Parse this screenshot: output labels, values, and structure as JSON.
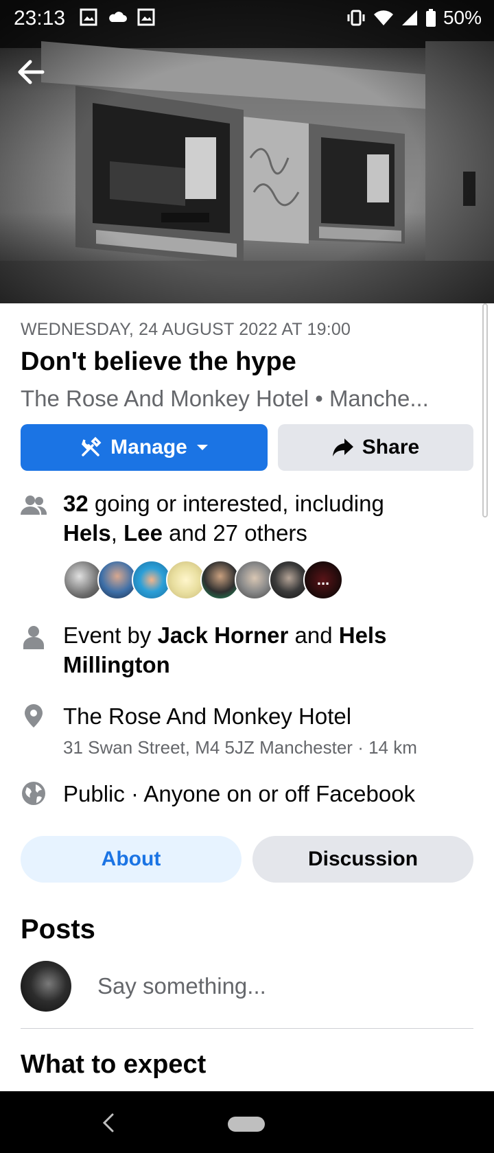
{
  "status_bar": {
    "time": "23:13",
    "battery": "50%"
  },
  "event": {
    "date": "WEDNESDAY, 24 AUGUST 2022 AT 19:00",
    "title": "Don't believe the hype",
    "location_line": "The Rose And Monkey Hotel • Manche..."
  },
  "actions": {
    "manage_label": "Manage",
    "share_label": "Share"
  },
  "attendance": {
    "count": "32",
    "text_after_count": " going or interested, including",
    "name_1": "Hels",
    "separator": ", ",
    "name_2": "Lee",
    "others": " and 27 others",
    "more_label": "..."
  },
  "host": {
    "prefix": "Event by ",
    "name_1": "Jack Horner",
    "joiner": " and ",
    "name_2": "Hels Millington"
  },
  "venue": {
    "name": "The Rose And Monkey Hotel",
    "address": "31 Swan Street, M4 5JZ Manchester · 14 km"
  },
  "privacy": {
    "text": "Public · Anyone on or off Facebook"
  },
  "tabs": [
    {
      "label": "About",
      "active": true
    },
    {
      "label": "Discussion",
      "active": false
    }
  ],
  "posts": {
    "heading": "Posts",
    "composer_placeholder": "Say something..."
  },
  "what_to_expect": {
    "heading": "What to expect"
  },
  "colors": {
    "primary_blue": "#1b74e4",
    "secondary_gray": "#e4e6eb",
    "muted_text": "#65676b",
    "active_tab_bg": "#e7f3ff"
  }
}
